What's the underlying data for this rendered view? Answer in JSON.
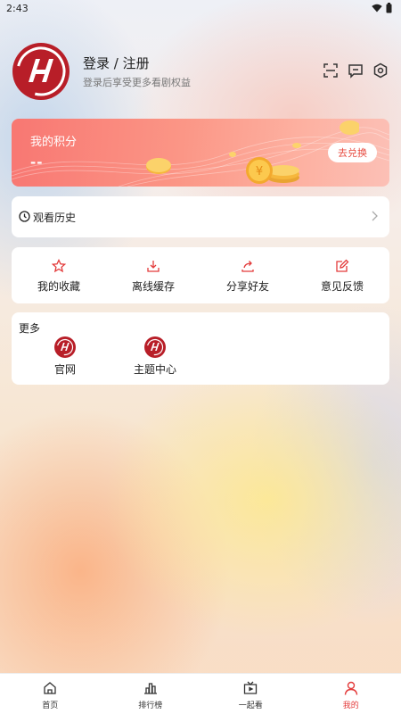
{
  "status": {
    "time": "2:43"
  },
  "profile": {
    "login_title": "登录 / 注册",
    "login_subtitle": "登录后享受更多看剧权益"
  },
  "header_icons": [
    "scan-icon",
    "message-icon",
    "settings-icon"
  ],
  "points": {
    "title": "我的积分",
    "value": "--",
    "redeem_label": "去兑换"
  },
  "history": {
    "label": "观看历史"
  },
  "actions": [
    {
      "label": "我的收藏",
      "icon": "star-icon"
    },
    {
      "label": "离线缓存",
      "icon": "download-icon"
    },
    {
      "label": "分享好友",
      "icon": "share-icon"
    },
    {
      "label": "意见反馈",
      "icon": "edit-icon"
    }
  ],
  "more": {
    "title": "更多",
    "items": [
      {
        "label": "官网",
        "icon": "site-logo-icon"
      },
      {
        "label": "主题中心",
        "icon": "site-logo-icon"
      }
    ]
  },
  "tabbar": [
    {
      "label": "首页",
      "icon": "home-icon",
      "active": false
    },
    {
      "label": "排行榜",
      "icon": "ranking-icon",
      "active": false
    },
    {
      "label": "一起看",
      "icon": "tv-icon",
      "active": false
    },
    {
      "label": "我的",
      "icon": "user-icon",
      "active": true
    }
  ],
  "colors": {
    "accent": "#e33b3b",
    "brand": "#b81e28",
    "card_gradient_start": "#f87772"
  }
}
